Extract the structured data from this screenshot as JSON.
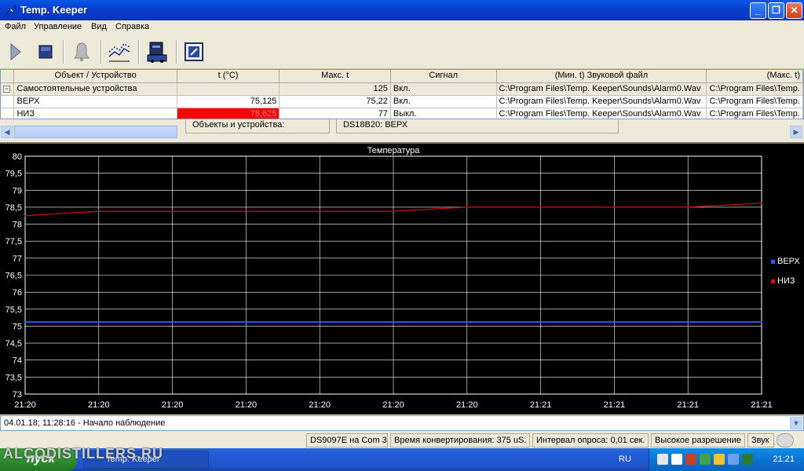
{
  "window": {
    "title": "Temp. Keeper"
  },
  "menu": [
    "Файл",
    "Управление",
    "Вид",
    "Справка"
  ],
  "toolbar": {
    "icons": [
      "play-icon",
      "stop-icon",
      "bell-icon",
      "chart-icon",
      "device-icon",
      "settings-icon"
    ]
  },
  "grid": {
    "headers": [
      "Объект / Устройство",
      "t (°C)",
      "Макс. t",
      "Сигнал",
      "(Мин. t) Звуковой файл",
      "(Макс. t)"
    ],
    "group": {
      "expander": "−",
      "label": "Самостоятельные устройства",
      "max": "125",
      "signal": "Вкл.",
      "file_min": "C:\\Program Files\\Temp. Keeper\\Sounds\\Alarm0.Wav",
      "file_max": "C:\\Program Files\\Temp."
    },
    "rows": [
      {
        "name": "ВЕРХ",
        "t": "75,125",
        "max": "75,22",
        "signal": "Вкл.",
        "file_min": "C:\\Program Files\\Temp. Keeper\\Sounds\\Alarm0.Wav",
        "file_max": "C:\\Program Files\\Temp."
      },
      {
        "name": "НИЗ",
        "t": "78,625",
        "max": "77",
        "signal": "Выкл.",
        "file_min": "C:\\Program Files\\Temp. Keeper\\Sounds\\Alarm0.Wav",
        "file_max": "C:\\Program Files\\Temp."
      }
    ]
  },
  "panel": {
    "objects_label": "Объекты и устройства:",
    "device_label": "DS18B20: ВЕРХ"
  },
  "chart_data": {
    "type": "line",
    "title": "Температура",
    "ylim": [
      73,
      80
    ],
    "y_ticks": [
      "80",
      "79,5",
      "79",
      "78,5",
      "78",
      "77,5",
      "77",
      "76,5",
      "76",
      "75,5",
      "75",
      "74,5",
      "74",
      "73,5",
      "73"
    ],
    "x_ticks": [
      "21:20",
      "21:20",
      "21:20",
      "21:20",
      "21:20",
      "21:20",
      "21:20",
      "21:21",
      "21:21",
      "21:21",
      "21:21"
    ],
    "grid": true,
    "legend_position": "right",
    "series": [
      {
        "name": "ВЕРХ",
        "color": "#2a5cff",
        "values": [
          75.12,
          75.12,
          75.12,
          75.12,
          75.12,
          75.12,
          75.12,
          75.12,
          75.12,
          75.12,
          75.12
        ]
      },
      {
        "name": "НИЗ",
        "color": "#d01010",
        "values": [
          78.25,
          78.38,
          78.38,
          78.38,
          78.38,
          78.38,
          78.5,
          78.5,
          78.5,
          78.5,
          78.62
        ]
      }
    ]
  },
  "log": {
    "text": "04.01.18; 11:28:16 - Начало наблюдение"
  },
  "status": {
    "port": "DS9097E на Com 3",
    "conversion": "Время конвертирования: 375 uS.",
    "interval": "Интервал опроса: 0,01 сек.",
    "resolution": "Высокое разрешение",
    "sound": "Звук"
  },
  "taskbar": {
    "start": "пуск",
    "task": "Temp. Keeper",
    "lang": "RU",
    "clock": "21:21"
  },
  "watermark": "ALCODISTILLERS.RU"
}
